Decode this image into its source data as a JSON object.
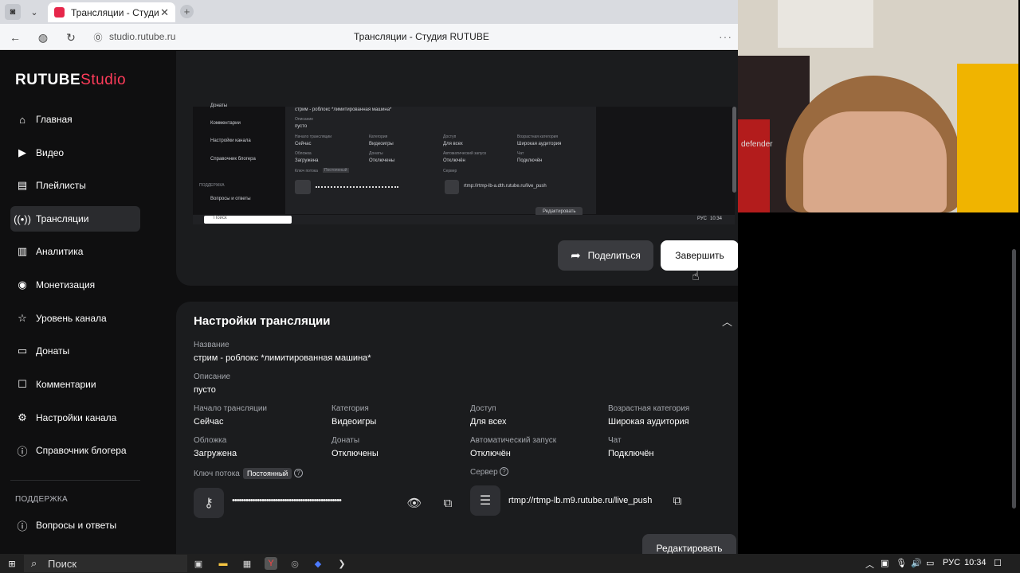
{
  "browser": {
    "tab_title": "Трансляции - Студи",
    "tab_close": "✕",
    "url": "studio.rutube.ru",
    "page_title": "Трансляции - Студия RUTUBE"
  },
  "logo": {
    "brand": "RUTUBE",
    "suffix": "Studio"
  },
  "sidebar": {
    "items": [
      {
        "label": "Главная",
        "icon": "home-icon"
      },
      {
        "label": "Видео",
        "icon": "video-icon"
      },
      {
        "label": "Плейлисты",
        "icon": "playlist-icon"
      },
      {
        "label": "Трансляции",
        "icon": "broadcast-icon",
        "active": true
      },
      {
        "label": "Аналитика",
        "icon": "analytics-icon"
      },
      {
        "label": "Монетизация",
        "icon": "money-icon"
      },
      {
        "label": "Уровень канала",
        "icon": "star-icon"
      },
      {
        "label": "Донаты",
        "icon": "donate-icon"
      },
      {
        "label": "Комментарии",
        "icon": "comment-icon"
      },
      {
        "label": "Настройки канала",
        "icon": "gear-icon"
      },
      {
        "label": "Справочник блогера",
        "icon": "info-icon"
      }
    ],
    "support_heading": "ПОДДЕРЖКА",
    "support_items": [
      {
        "label": "Вопросы и ответы",
        "icon": "help-icon"
      }
    ]
  },
  "preview": {
    "side_items": [
      "Донаты",
      "Комментарии",
      "Настройки канала",
      "Справочник блогера"
    ],
    "support": "ПОДДЕРЖКА",
    "support_item": "Вопросы и ответы",
    "title": "стрим - роблокс *лимитированная машина*",
    "desc_label": "Описание",
    "desc": "пусто",
    "rows": [
      [
        "Начало трансляции",
        "Сейчас",
        "Категория",
        "Видеоигры",
        "Доступ",
        "Для всех",
        "Возрастная категория",
        "Широкая аудитория"
      ],
      [
        "Обложка",
        "Загружена",
        "Донаты",
        "Отключены",
        "Автоматический запуск",
        "Отключён",
        "Чат",
        "Подключён"
      ]
    ],
    "key_label": "Ключ потока",
    "key_badge": "Постоянный",
    "server_label": "Сервер",
    "server": "rtmp://rtmp-lb-a.dth.rutube.ru/live_push",
    "edit": "Редактировать",
    "search": "Поиск",
    "clock": "10:34",
    "lang": "РУС"
  },
  "actions": {
    "share": "Поделиться",
    "finish": "Завершить"
  },
  "settings": {
    "title": "Настройки трансляции",
    "name_label": "Название",
    "name": "стрим - роблокс *лимитированная машина*",
    "desc_label": "Описание",
    "desc": "пусто",
    "start_label": "Начало трансляции",
    "start": "Сейчас",
    "category_label": "Категория",
    "category": "Видеоигры",
    "access_label": "Доступ",
    "access": "Для всех",
    "age_label": "Возрастная категория",
    "age": "Широкая аудитория",
    "cover_label": "Обложка",
    "cover": "Загружена",
    "donates_label": "Донаты",
    "donates": "Отключены",
    "autostart_label": "Автоматический запуск",
    "autostart": "Отключён",
    "chat_label": "Чат",
    "chat": "Подключён",
    "key_label": "Ключ потока",
    "key_badge": "Постоянный",
    "key_masked": "••••••••••••••••••••••••••••••••••••••••••••••••",
    "server_label": "Сервер",
    "server": "rtmp://rtmp-lb.m9.rutube.ru/live_push",
    "edit": "Редактировать"
  },
  "taskbar": {
    "search": "Поиск",
    "lang": "РУС",
    "time": "10:34"
  },
  "webcam": {
    "brand": "defender"
  },
  "colors": {
    "accent": "#ff3c5a",
    "background": "#0f0f10",
    "card": "#1b1c1e",
    "active_nav": "#2a2b2e"
  }
}
